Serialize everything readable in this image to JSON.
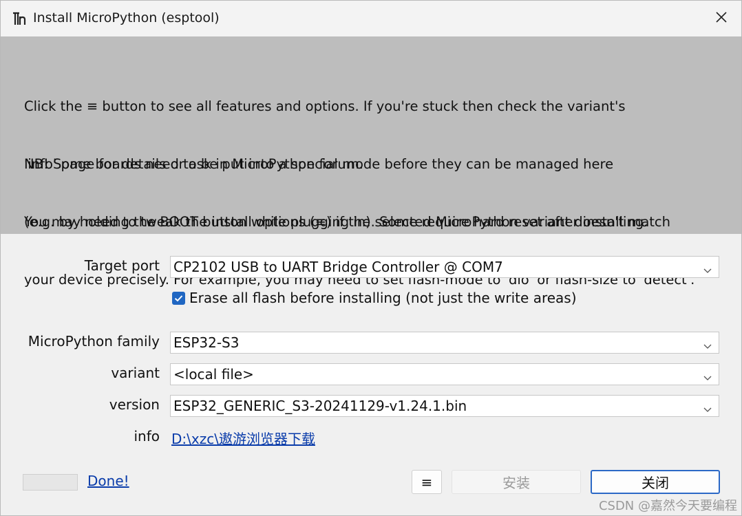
{
  "window": {
    "title": "Install MicroPython (esptool)"
  },
  "info_text": {
    "p1_line1": "Click the ≡ button to see all features and options. If you're stuck then check the variant's",
    "p1_line2": "'info' page for details or ask in MicroPython forum.",
    "p2_line1": "NB! Some boards need to be put into a special mode before they can be managed here",
    "p2_line2": "(e.g. by holding the BOOT button while plugging in). Some require hard reset after installing.",
    "p3_line1": "You may need to tweak the install options (≡) if the selected MicroPython variant doesn't match",
    "p3_line2": "your device precisely. For example, you may need to set flash-mode to 'dio' or flash-size to 'detect'."
  },
  "form": {
    "target_port_label": "Target port",
    "target_port_value": "CP2102 USB to UART Bridge Controller @ COM7",
    "erase_label": "Erase all flash before installing (not just the write areas)",
    "erase_checked": true,
    "family_label": "MicroPython family",
    "family_value": "ESP32-S3",
    "variant_label": "variant",
    "variant_value": "<local file>",
    "version_label": "version",
    "version_value": "ESP32_GENERIC_S3-20241129-v1.24.1.bin",
    "info_label": "info",
    "info_link": "D:\\xzc\\遨游浏览器下载"
  },
  "footer": {
    "done_link": "Done!",
    "menu_button": "≡",
    "install_button": "安装",
    "close_button": "关闭",
    "watermark": "CSDN @嘉然今天要编程"
  },
  "colors": {
    "info_panel_bg": "#bdbdbd",
    "accent": "#1f66c2",
    "link": "#0a3caa"
  },
  "icons": {
    "app": "thonny-icon",
    "close": "close-icon",
    "dropdown": "chevron-down-icon",
    "check": "checkmark-icon"
  }
}
